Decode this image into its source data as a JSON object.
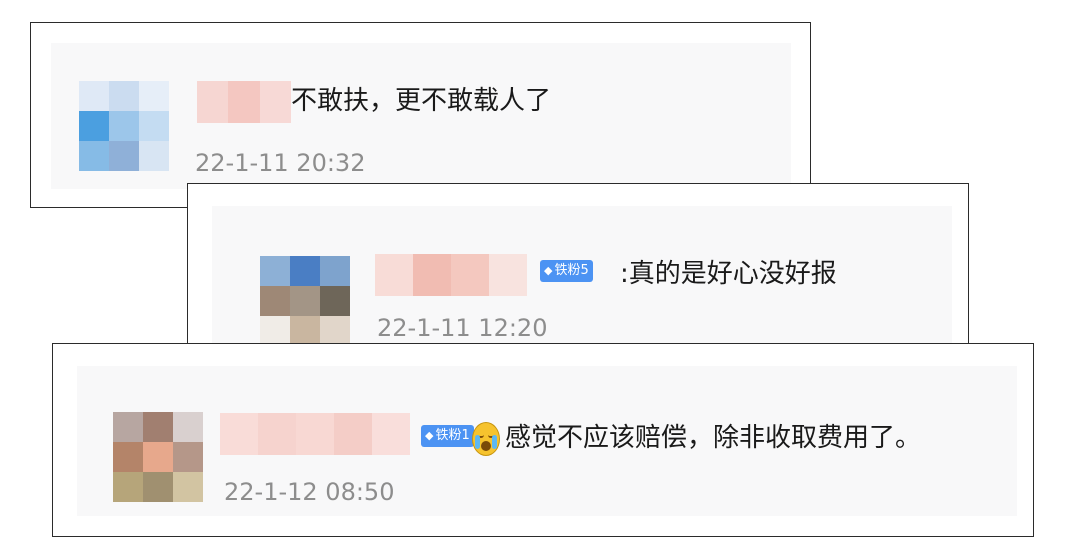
{
  "comments": [
    {
      "text": "不敢扶，更不敢载人了",
      "time": "22-1-11 20:32",
      "avatar_colors": [
        "#dfe9f6",
        "#cbdcf0",
        "#e6eef8",
        "#4b9fe0",
        "#9cc6ea",
        "#c4dcf2",
        "#86bbe6",
        "#8fb0d8",
        "#d8e5f3"
      ],
      "name_colors": [
        "#f6d6d2",
        "#f4c7c1",
        "#f7d9d6"
      ]
    },
    {
      "badge": "铁粉5",
      "text": ":真的是好心没好报",
      "time": "22-1-11 12:20",
      "avatar_colors": [
        "#8db0d6",
        "#4a7ec4",
        "#7ea3cd",
        "#9e8876",
        "#a39586",
        "#6e6659",
        "#f0ece7",
        "#c9b6a0",
        "#e1d6ca"
      ],
      "name_colors": [
        "#f8dcd7",
        "#f1bcb2",
        "#f4c8bf",
        "#f8e3df"
      ]
    },
    {
      "badge": "铁粉1",
      "text": "感觉不应该赔偿，除非收取费用了。",
      "time": "22-1-12 08:50",
      "emoji": "crying-face-icon",
      "avatar_colors": [
        "#b7a6a1",
        "#a17f70",
        "#d9d0cf",
        "#b48469",
        "#e7a88c",
        "#b59789",
        "#b6a57a",
        "#a09070",
        "#d2c4a2"
      ],
      "name_colors": [
        "#f9dcd8",
        "#f6d3ce",
        "#f8d8d3",
        "#f4cdc7",
        "#f9dedb"
      ]
    }
  ],
  "colors": {
    "badge_bg": "#4c93f3",
    "timestamp": "#8d8d8d",
    "text": "#1a1a1a"
  },
  "badge_icon": "diamond-icon"
}
